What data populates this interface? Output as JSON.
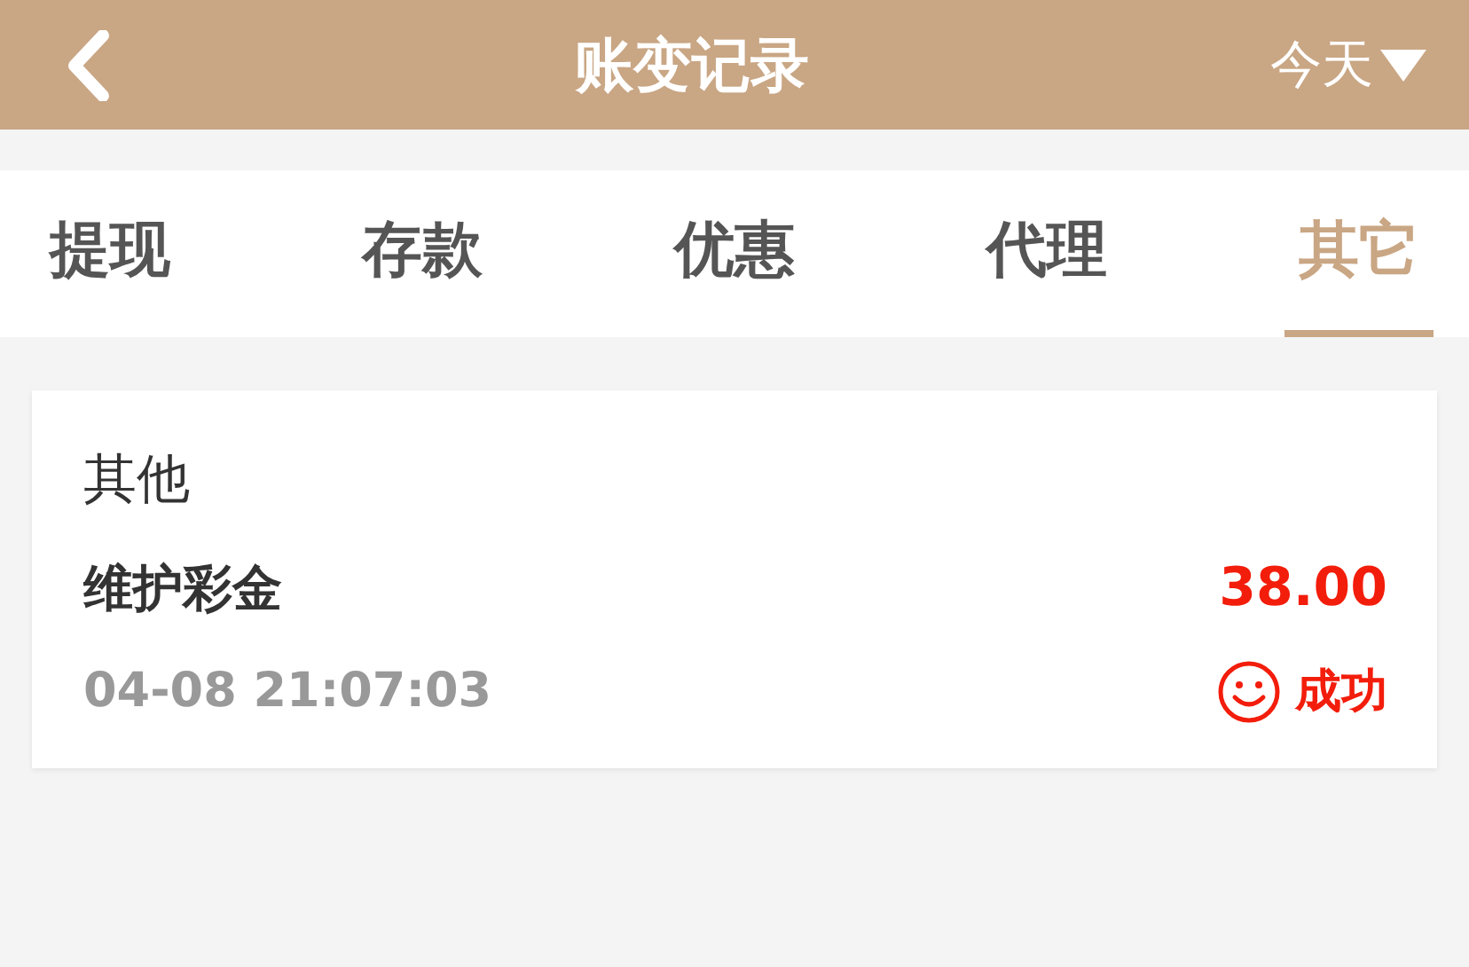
{
  "header": {
    "title": "账变记录",
    "filter": "今天"
  },
  "tabs": [
    {
      "label": "提现",
      "selected": false
    },
    {
      "label": "存款",
      "selected": false
    },
    {
      "label": "优惠",
      "selected": false
    },
    {
      "label": "代理",
      "selected": false
    },
    {
      "label": "其它",
      "selected": true
    }
  ],
  "records": [
    {
      "category": "其他",
      "name": "维护彩金",
      "amount": "38.00",
      "time": "04-08 21:07:03",
      "status": "成功"
    }
  ]
}
